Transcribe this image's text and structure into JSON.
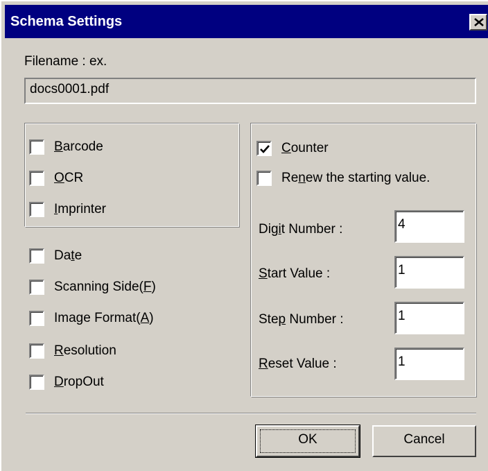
{
  "window": {
    "title": "Schema Settings",
    "close_label": "×"
  },
  "filename": {
    "label": "Filename : ex.",
    "value": "docs0001.pdf"
  },
  "left_group": [
    {
      "label_u": "B",
      "label_rest": "arcode",
      "checked": false
    },
    {
      "label_u": "O",
      "label_rest": "CR",
      "checked": false
    },
    {
      "label_u": "I",
      "label_rest": "mprinter",
      "checked": false
    }
  ],
  "left_options": {
    "date": {
      "pre": "Da",
      "u": "t",
      "post": "e"
    },
    "scanning_side": {
      "pre": "Scanning Side(",
      "u": "F",
      "post": ")"
    },
    "image_format": {
      "pre": "Image Format(",
      "u": "A",
      "post": ")"
    },
    "resolution": {
      "pre": "",
      "u": "R",
      "post": "esolution"
    },
    "dropout": {
      "pre": "",
      "u": "D",
      "post": "ropOut"
    }
  },
  "counter": {
    "counter_label": {
      "pre": "",
      "u": "C",
      "post": "ounter"
    },
    "counter_checked": true,
    "renew_label": {
      "pre": "Re",
      "u": "n",
      "post": "ew the starting value."
    },
    "renew_checked": false,
    "digit": {
      "pre": "Dig",
      "u": "i",
      "post": "t Number :",
      "value": "4"
    },
    "start": {
      "pre": "",
      "u": "S",
      "post": "tart Value :",
      "value": "1"
    },
    "step": {
      "pre": "Ste",
      "u": "p",
      "post": " Number :",
      "value": "1"
    },
    "reset": {
      "pre": "",
      "u": "R",
      "post": "eset Value :",
      "value": "1"
    }
  },
  "buttons": {
    "ok": "OK",
    "cancel": "Cancel"
  }
}
